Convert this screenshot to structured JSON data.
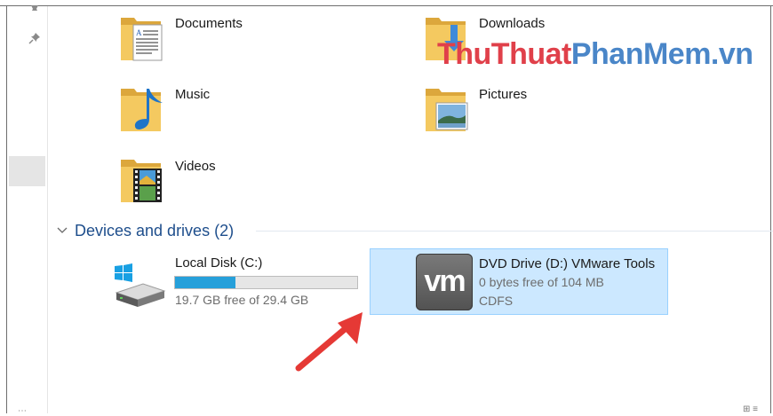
{
  "folders": [
    {
      "label": "Documents",
      "icon": "documents-folder-icon"
    },
    {
      "label": "Downloads",
      "icon": "downloads-folder-icon"
    },
    {
      "label": "Music",
      "icon": "music-folder-icon"
    },
    {
      "label": "Pictures",
      "icon": "pictures-folder-icon"
    },
    {
      "label": "Videos",
      "icon": "videos-folder-icon"
    }
  ],
  "devices": {
    "header": "Devices and drives (2)",
    "drives": [
      {
        "name": "Local Disk (C:)",
        "free_text": "19.7 GB free of 29.4 GB",
        "used_fraction": 0.33,
        "icon": "windows-drive-icon"
      },
      {
        "name": "DVD Drive (D:) VMware Tools",
        "free_text": "0 bytes free of 104 MB",
        "filesystem": "CDFS",
        "logo_text": "vm",
        "icon": "vmware-logo-icon",
        "selected": true
      }
    ]
  },
  "watermark": {
    "part1": "ThuThuat",
    "part2": "PhanMem.vn"
  },
  "colors": {
    "accent": "#26a0da",
    "selection_bg": "#cce8ff",
    "selection_border": "#99d1ff",
    "group_header": "#1e4e8c",
    "arrow": "#e53935",
    "folder": "#f4c960"
  }
}
